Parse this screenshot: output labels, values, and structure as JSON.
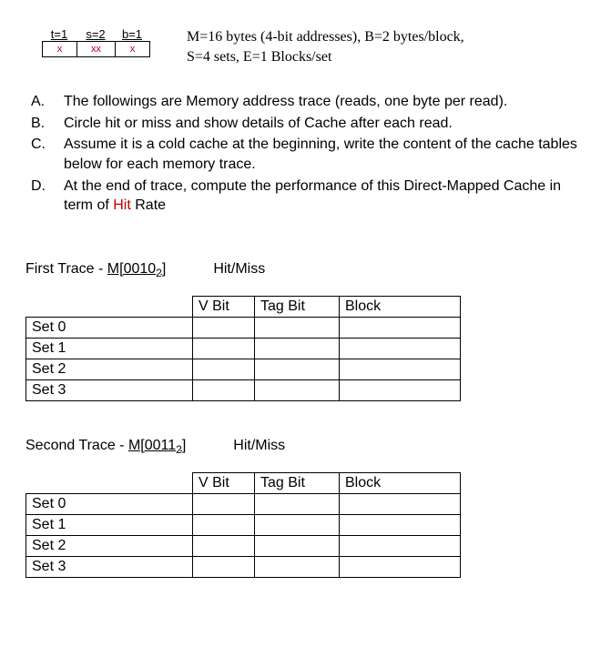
{
  "addr": {
    "labels": {
      "t": "t=1",
      "s": "s=2",
      "b": "b=1"
    },
    "cells": {
      "t": "x",
      "s": "xx",
      "b": "x"
    }
  },
  "config": {
    "line1": "M=16 bytes (4-bit addresses), B=2 bytes/block,",
    "line2": "S=4 sets, E=1 Blocks/set"
  },
  "questions": {
    "a": {
      "letter": "A.",
      "text": "The followings are Memory address trace (reads, one byte per read)."
    },
    "b": {
      "letter": "B.",
      "text": "Circle hit or miss and show details of Cache after each read."
    },
    "c": {
      "letter": "C.",
      "text": "Assume it is a cold cache at the beginning, write the content of the cache tables below for each memory trace."
    },
    "d": {
      "letter": "D.",
      "pre": "At the end of trace, compute the performance of this Direct-Mapped Cache in term of ",
      "hit": "Hit",
      "post": " Rate"
    }
  },
  "traces": {
    "first": {
      "label_pre": "First Trace ",
      "dash": "- ",
      "m_pre": "M[0010",
      "sub": "2",
      "m_post": "]",
      "hm": "Hit/Miss"
    },
    "second": {
      "label_pre": "Second Trace ",
      "dash": "- ",
      "m_pre": "M[0011",
      "sub": "2",
      "m_post": "]",
      "hm": "Hit/Miss"
    }
  },
  "table": {
    "headers": {
      "vbit": "V Bit",
      "tagbit": "Tag Bit",
      "block": "Block"
    },
    "rows": {
      "r0": "Set 0",
      "r1": "Set 1",
      "r2": "Set 2",
      "r3": "Set 3"
    },
    "first": {
      "r0": {
        "v": "",
        "t": "",
        "b": ""
      },
      "r1": {
        "v": "",
        "t": "",
        "b": ""
      },
      "r2": {
        "v": "",
        "t": "",
        "b": ""
      },
      "r3": {
        "v": "",
        "t": "",
        "b": ""
      }
    },
    "second": {
      "r0": {
        "v": "",
        "t": "",
        "b": ""
      },
      "r1": {
        "v": "",
        "t": "",
        "b": ""
      },
      "r2": {
        "v": "",
        "t": "",
        "b": ""
      },
      "r3": {
        "v": "",
        "t": "",
        "b": ""
      }
    }
  }
}
